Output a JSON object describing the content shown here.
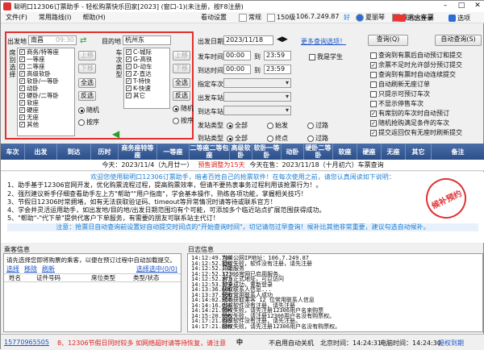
{
  "window": {
    "title": "聪明口12306订票助手 - 轻松购票快乐回家[2023] (窗口-1)(未注册，按F8注册)"
  },
  "menu": {
    "items": [
      "文件(F)",
      "常用路线(I)",
      "帮助(H)"
    ]
  },
  "top_right": {
    "tickets_label": "看动设置",
    "network": "常规",
    "level": "150级",
    "ip": "106.7.249.87",
    "good": "好",
    "user": "夏丽琴",
    "cart": "我的火车票",
    "exit": "退出登录",
    "options": "选项"
  },
  "form": {
    "from_label": "出发地",
    "from_value": "南昌",
    "from_time": "09:30",
    "to_label": "目的地",
    "to_value": "杭州东",
    "date_label": "出发日期",
    "date_value": "2023/11/18",
    "more_settings": "更多查询选项！",
    "query_btn": "查询(Q)",
    "auto_query_btn": "自动查询(S)",
    "seat_title": "席别选择",
    "train_title": "车次类型",
    "seats": [
      {
        "label": "商务/特等座",
        "checked": true
      },
      {
        "label": "一等座",
        "checked": true
      },
      {
        "label": "二等座",
        "checked": true
      },
      {
        "label": "高级软卧",
        "checked": true
      },
      {
        "label": "软卧/一等卧",
        "checked": true
      },
      {
        "label": "动卧",
        "checked": true
      },
      {
        "label": "硬卧/二等卧",
        "checked": true
      },
      {
        "label": "软座",
        "checked": true
      },
      {
        "label": "硬座",
        "checked": true
      },
      {
        "label": "无座",
        "checked": true
      },
      {
        "label": "其他",
        "checked": true
      }
    ],
    "trains": [
      {
        "label": "C-城际",
        "checked": true
      },
      {
        "label": "G-高铁",
        "checked": true
      },
      {
        "label": "D-动车",
        "checked": true
      },
      {
        "label": "Z-直达",
        "checked": true
      },
      {
        "label": "T-特快",
        "checked": true
      },
      {
        "label": "K-快速",
        "checked": true
      },
      {
        "label": "其它",
        "checked": true
      }
    ],
    "move_up": "上移",
    "move_down": "下移",
    "select_all": "全选",
    "invert": "反选",
    "random": "随机",
    "by_order": "按序",
    "depart_time_label": "发车时间",
    "depart_from": "00:00",
    "depart_to": "23:59",
    "arrive_time_label": "到达时间",
    "arrive_from": "00:00",
    "arrive_to": "23:59",
    "student_label": "我是学生",
    "fix_train_label": "指定车次",
    "depart_station_label": "出发车站",
    "arrive_station_label": "到达车站",
    "depart_type_label": "发站类型",
    "arrive_type_label": "到站类型",
    "type_all": "全部",
    "type_origin": "始发",
    "type_pass": "过路",
    "type_end": "终点",
    "options": [
      "查询到有票后自动预订和提交",
      "余票不足时允许部分预订提交",
      "查询到有票时自动连续提交",
      "自动刷新无座订单",
      "只提示可预订车次",
      "不显示停售车次",
      "有席别的车次时自动预订",
      "随机抢购满足条件的车次",
      "提交返回仅有无座时刷新提交"
    ]
  },
  "table": {
    "headers": [
      "车次",
      "出发",
      "到达",
      "历时",
      "商务座特等座",
      "一等座",
      "二等座二等包座",
      "高级软卧",
      "软卧一等卧",
      "动卧",
      "硬卧二等卧",
      "软座",
      "硬座",
      "无座",
      "其它",
      "备注"
    ]
  },
  "dates": {
    "today": "今天：2023/11/4（九月廿一）",
    "presale": "预售调整为15天",
    "sale_day": "今天在售：2023/11/18（十月初六）车票查询"
  },
  "notice": {
    "title": "欢迎您使用聪明口12306订票助手，暗者百姓自己的抢票软件！在每次使用之前，请您认真阅读如下说明：",
    "lines": [
      "1、助手基于12306官网开发，优化购票流程过程，提高购票效率，但请不要热衷事务过程利用该抢票行为！。",
      "2、强烈建议新手仔细查看助手左上方\"帮助\"\"用户指南\"，学会基本操作，熟练各项功能，掌握相关技巧！",
      "3、节假日12306时常拥堵，如有无法获取验证码、timeout等异常情况时请等待或联系官方！",
      "4、学会并灵活运用助手，如出发地/目的地/出发日期范围均有个可能，可添加多个临近站点扩展范围获得成功。",
      "5、\"帮助\"-\"代下单\"提供代客户下单服务，有需要的朋友可联系站主代订！"
    ],
    "bar": "注意：抢票日自动查询前设置好自动提交时间点的\"开始查询时间\"，切记请勿过早查询！候补比其他非常重要，建议勾选自动候补。"
  },
  "seal": "候补预约",
  "passengers": {
    "title": "乘客信息",
    "hint": "请先选择您即将购票的乘客，以便在预订过程中自动加载提交。",
    "select_all": "选择",
    "remove": "移除",
    "refresh": "刷新",
    "refresh2": "选择选中(0/0)",
    "columns": [
      "姓名",
      "证件号码",
      "席位类型",
      "类型/状态"
    ]
  },
  "log": {
    "title": "日志信息",
    "lines": [
      [
        "14:12:49.704",
        "当前公网IP地址：106.7.249.87"
      ],
      [
        "14:12:52.132",
        "授权失败，软件没有注册，请先注册"
      ],
      [
        "14:12:52.132",
        "开始服务"
      ],
      [
        "14:12:52.373",
        "12306官网已启用服务。"
      ],
      [
        "14:12:52.373",
        "官方正式地址，可以访问"
      ],
      [
        "14:12:53.376",
        "登录成功，重新登录"
      ],
      [
        "14:13:36.606",
        "获取联系人信息..."
      ],
      [
        "14:13:37.996",
        "获取常用联系人成功"
      ],
      [
        "14:14:02.956",
        "成功获取乘客 12 位常用联系人信息"
      ],
      [
        "14:14:16.056",
        "当前软件没有注册，请先注册"
      ],
      [
        "14:14:21.994",
        "授权失败，请先注册12306用户名来购票"
      ],
      [
        "14:15:20.995",
        "授权失败，请注册12306用户名没有购票权。"
      ],
      [
        "14:17:21.889",
        "当前软件没有注册，请先注册。"
      ],
      [
        "14:17:21.889",
        "授权失败，请先注册12306用户名没有购票权。"
      ]
    ]
  },
  "statusbar": {
    "phone": "15770965505",
    "scroll": "8、12306节假日同时较多 如网络超时请等待恢复，请注意",
    "ime": "中",
    "auto_close": "不启用自动关机",
    "beijing_time": "北京时间：14:24:31",
    "pc_time": "电脑时间：14:24:30",
    "register": "授权到期"
  }
}
